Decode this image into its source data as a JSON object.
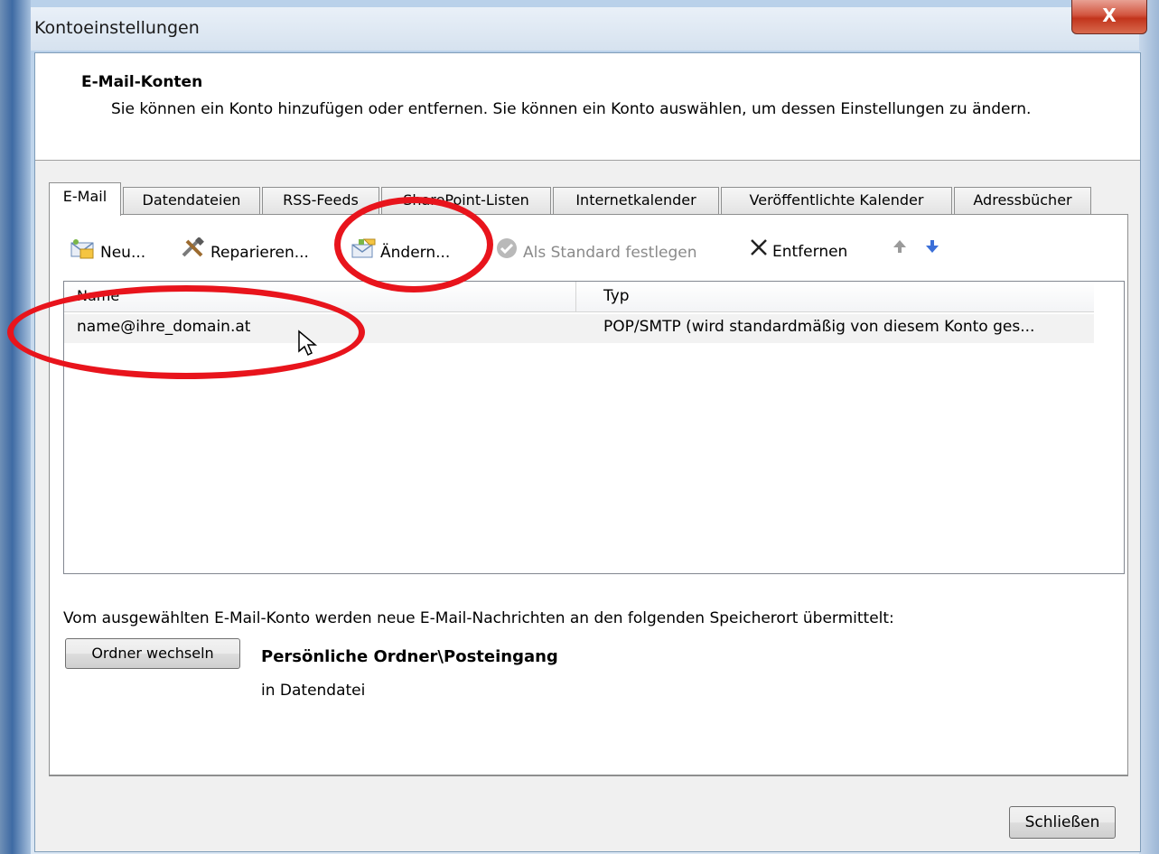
{
  "window": {
    "title": "Kontoeinstellungen",
    "close_glyph": "X"
  },
  "header": {
    "title": "E-Mail-Konten",
    "description": "Sie können ein Konto hinzufügen oder entfernen. Sie können ein Konto auswählen, um dessen Einstellungen zu ändern."
  },
  "tabs": [
    {
      "label": "E-Mail",
      "active": true
    },
    {
      "label": "Datendateien",
      "active": false
    },
    {
      "label": "RSS-Feeds",
      "active": false
    },
    {
      "label": "SharePoint-Listen",
      "active": false
    },
    {
      "label": "Internetkalender",
      "active": false
    },
    {
      "label": "Veröffentlichte Kalender",
      "active": false
    },
    {
      "label": "Adressbücher",
      "active": false
    }
  ],
  "toolbar": {
    "new_label": "Neu...",
    "repair_label": "Reparieren...",
    "change_label": "Ändern...",
    "default_label": "Als Standard festlegen",
    "remove_label": "Entfernen"
  },
  "list": {
    "columns": [
      "Name",
      "Typ"
    ],
    "rows": [
      {
        "name": "name@ihre_domain.at",
        "type": "POP/SMTP (wird standardmäßig von diesem Konto ges..."
      }
    ]
  },
  "delivery": {
    "info": "Vom ausgewählten E-Mail-Konto werden neue E-Mail-Nachrichten an den folgenden Speicherort übermittelt:",
    "change_folder_label": "Ordner wechseln",
    "folder_path": "Persönliche Ordner\\Posteingang",
    "folder_sub": "in Datendatei"
  },
  "footer": {
    "close_label": "Schließen"
  },
  "colors": {
    "annotation": "#e8141c",
    "arrow_up": "#9a9a9a",
    "arrow_down": "#3b6fd8"
  }
}
